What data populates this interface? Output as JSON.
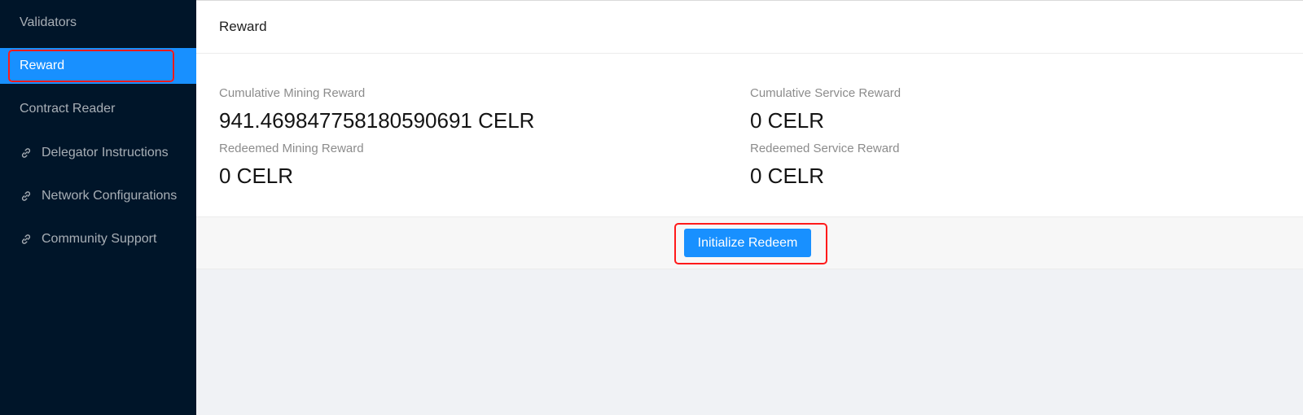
{
  "sidebar": {
    "items": [
      {
        "label": "Validators",
        "icon": null,
        "selected": false
      },
      {
        "label": "Reward",
        "icon": null,
        "selected": true
      },
      {
        "label": "Contract Reader",
        "icon": null,
        "selected": false
      },
      {
        "label": "Delegator Instructions",
        "icon": "link-icon",
        "selected": false
      },
      {
        "label": "Network Configurations",
        "icon": "link-icon",
        "selected": false
      },
      {
        "label": "Community Support",
        "icon": "link-icon",
        "selected": false
      }
    ]
  },
  "card": {
    "title": "Reward",
    "stats": {
      "cumulative_mining": {
        "label": "Cumulative Mining Reward",
        "value": "941.469847758180590691 CELR"
      },
      "cumulative_service": {
        "label": "Cumulative Service Reward",
        "value": "0 CELR"
      },
      "redeemed_mining": {
        "label": "Redeemed Mining Reward",
        "value": "0 CELR"
      },
      "redeemed_service": {
        "label": "Redeemed Service Reward",
        "value": "0 CELR"
      }
    },
    "redeem_button_label": "Initialize Redeem"
  },
  "colors": {
    "sidebar_bg": "#001529",
    "accent": "#1890ff",
    "highlight": "#ff1a1a"
  }
}
